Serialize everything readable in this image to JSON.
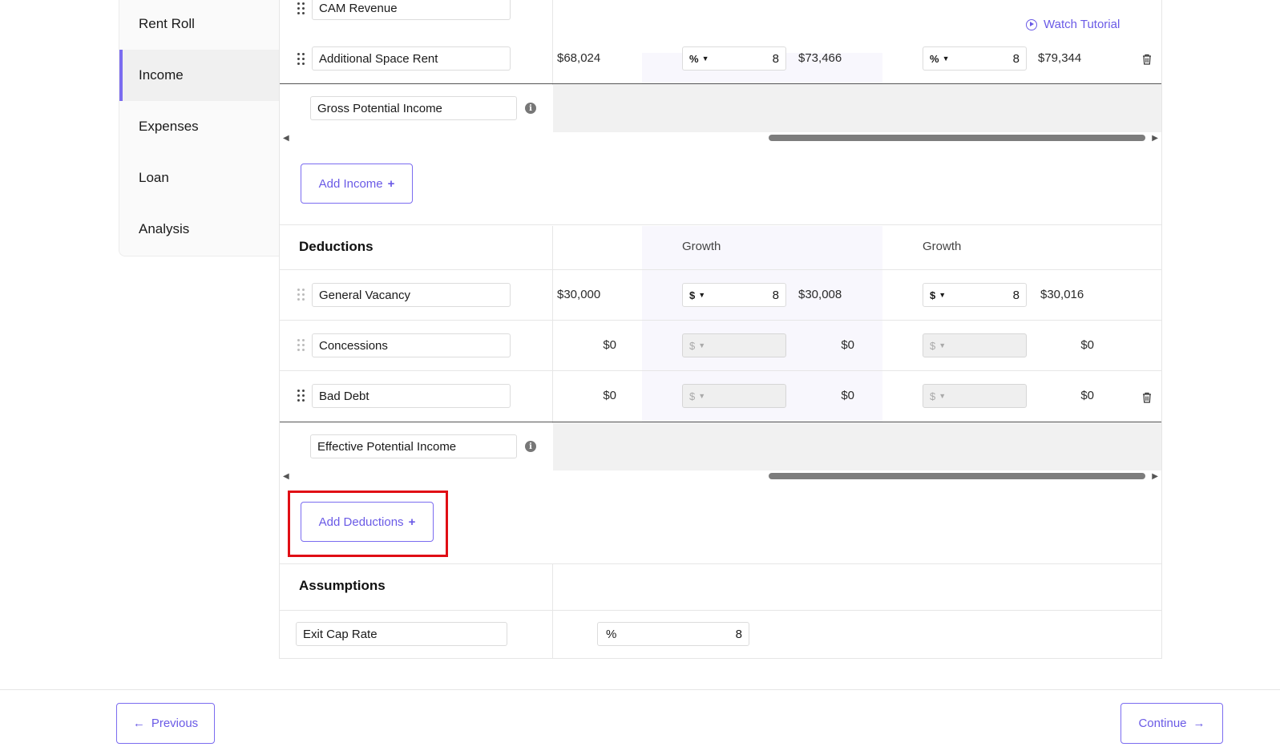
{
  "sidebar": {
    "items": [
      {
        "label": "Rent Roll",
        "active": false
      },
      {
        "label": "Income",
        "active": true
      },
      {
        "label": "Expenses",
        "active": false
      },
      {
        "label": "Loan",
        "active": false
      },
      {
        "label": "Analysis",
        "active": false
      }
    ]
  },
  "header": {
    "watch_tutorial": "Watch Tutorial"
  },
  "income": {
    "rows": [
      {
        "name": "CAM Revenue"
      },
      {
        "name": "Additional Space Rent",
        "year1": "$68,024",
        "growth1_unit": "%",
        "growth1_value": "8",
        "year2": "$73,466",
        "growth2_unit": "%",
        "growth2_value": "8",
        "year3": "$79,344"
      }
    ],
    "total_label": "Gross Potential Income",
    "add_button": "Add Income",
    "plus": "+"
  },
  "deductions": {
    "title": "Deductions",
    "growth_header_1": "Growth",
    "growth_header_2": "Growth",
    "rows": [
      {
        "name": "General Vacancy",
        "year1": "$30,000",
        "growth1_unit": "$",
        "growth1_value": "8",
        "year2": "$30,008",
        "growth2_unit": "$",
        "growth2_value": "8",
        "year3": "$30,016"
      },
      {
        "name": "Concessions",
        "year1": "$0",
        "growth1_unit": "$",
        "year2": "$0",
        "growth2_unit": "$",
        "year3": "$0"
      },
      {
        "name": "Bad Debt",
        "year1": "$0",
        "growth1_unit": "$",
        "year2": "$0",
        "growth2_unit": "$",
        "year3": "$0"
      }
    ],
    "total_label": "Effective Potential Income",
    "add_button": "Add Deductions",
    "plus": "+"
  },
  "assumptions": {
    "title": "Assumptions",
    "rows": [
      {
        "name": "Exit Cap Rate",
        "unit": "%",
        "value": "8"
      }
    ]
  },
  "footer": {
    "previous": "Previous",
    "continue": "Continue",
    "prev_arrow": "←",
    "next_arrow": "→"
  },
  "icons": {
    "grip": "drag-handle-icon",
    "trash": "trash-icon",
    "info": "info-icon",
    "play": "play-circle-icon"
  },
  "colors": {
    "accent": "#7b6cf0",
    "highlight": "#e00e15"
  }
}
